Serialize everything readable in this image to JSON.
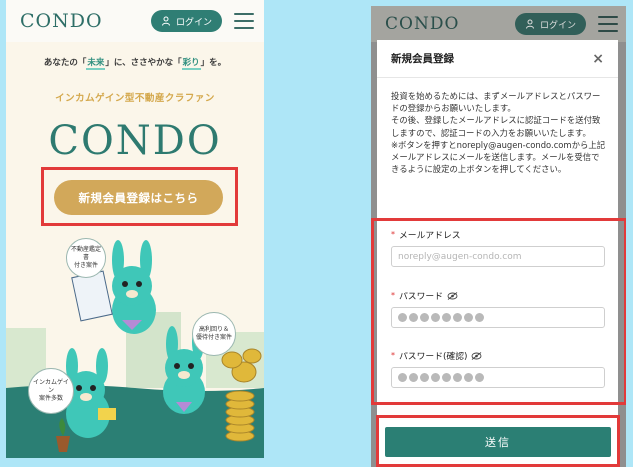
{
  "left": {
    "brand": "CONDO",
    "login_label": "ログイン",
    "tagline": {
      "part1": "あなたの「",
      "hl1": "未来",
      "part2": "」に、ささやかな「",
      "hl2": "彩り",
      "part3": "」を。"
    },
    "subline": "インカムゲイン型不動産クラファン",
    "big_logo": "CONDO",
    "cta_label": "新規会員登録はこちら",
    "bubbles": {
      "appraisal": "不動産鑑定書\n付き案件",
      "yield": "高利回り＆\n優待付き案件",
      "income": "インカムゲイン\n案件多数"
    },
    "document_label": "不動産鑑定書"
  },
  "right": {
    "brand": "CONDO",
    "login_label": "ログイン",
    "modal_title": "新規会員登録",
    "intro_text": "投資を始めるためには、まずメールアドレスとパスワードの登録からお願いいたします。\nその後、登録したメールアドレスに認証コードを送付致しますので、認証コードの入力をお願いいたします。\n※ボタンを押すとnoreply@augen-condo.comから上記メールアドレスにメールを送信します。メールを受信できるように設定の上ボタンを押してください。",
    "email_label": "メールアドレス",
    "email_placeholder": "noreply@augen-condo.com",
    "password_label": "パスワード",
    "password_confirm_label": "パスワード(確認)",
    "required_mark": "*",
    "submit_label": "送信"
  },
  "colors": {
    "brand_green": "#2e7a70",
    "accent_gold": "#d2a85a",
    "highlight_red": "#e23a3a",
    "background": "#aee6f7"
  }
}
